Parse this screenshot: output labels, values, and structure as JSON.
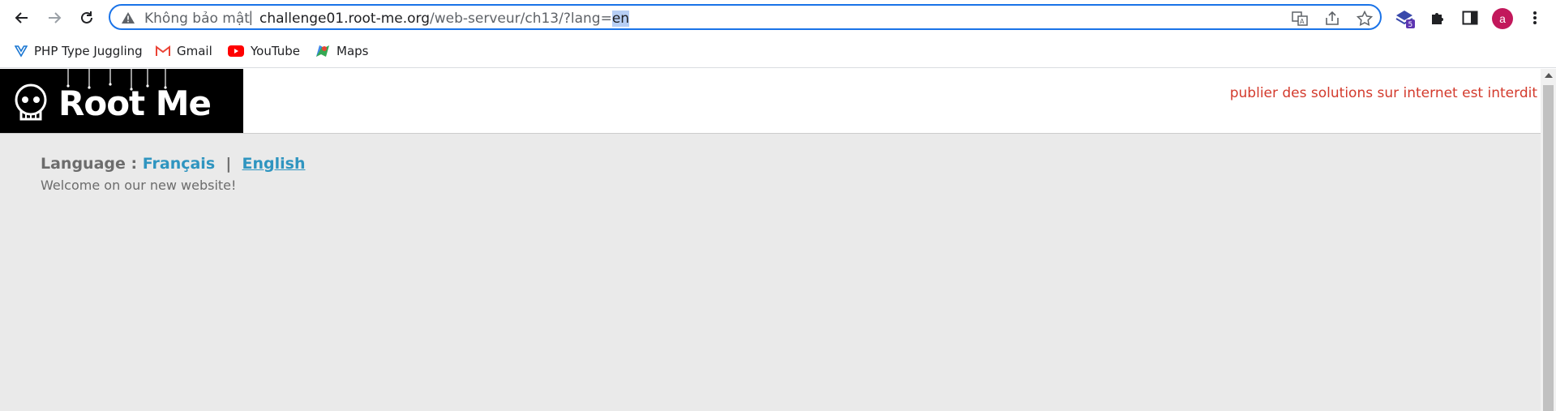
{
  "browser": {
    "back_icon": "arrow-left-icon",
    "forward_icon": "arrow-right-icon",
    "reload_icon": "reload-icon",
    "security_label": "Không bảo mật",
    "separator": "|",
    "url_host": "challenge01.root-me.org",
    "url_path": "/web-serveur/ch13/?lang=",
    "url_selected": "en",
    "avatar_letter": "a",
    "extension_badge": "5"
  },
  "bookmarks": [
    {
      "label": "PHP Type Juggling",
      "icon": "vuejs-icon"
    },
    {
      "label": "Gmail",
      "icon": "gmail-icon"
    },
    {
      "label": "YouTube",
      "icon": "youtube-icon"
    },
    {
      "label": "Maps",
      "icon": "maps-icon"
    }
  ],
  "site": {
    "logo_text": "Root Me",
    "notice": "publier des solutions sur internet est interdit",
    "language_label": "Language :",
    "lang_fr": "Français",
    "lang_sep": "|",
    "lang_en": "English",
    "welcome": "Welcome on our new website!"
  },
  "colors": {
    "accent": "#1a73e8",
    "notice": "#d33a2c",
    "link": "#2f95c0",
    "page_bg": "#eaeaea"
  }
}
